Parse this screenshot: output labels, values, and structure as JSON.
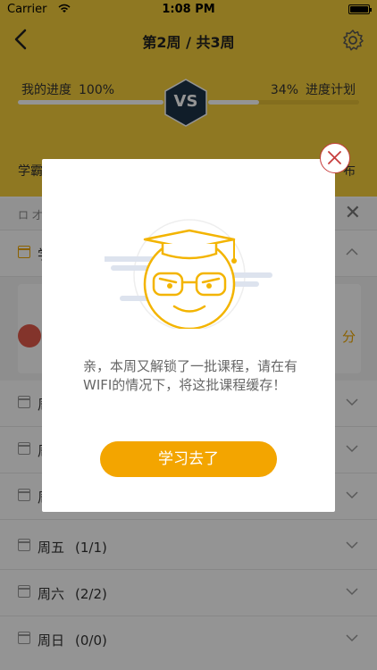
{
  "status_bar": {
    "carrier": "Carrier",
    "time": "1:08 PM",
    "battery_level": 1.0
  },
  "nav": {
    "title": "第2周 / 共3周",
    "back_icon": "chevron-left-icon",
    "settings_icon": "gear-icon"
  },
  "progress": {
    "mine_label": "我的进度",
    "mine_value": "100%",
    "mine_fraction": 1.0,
    "plan_value": "34%",
    "plan_label": "进度计划",
    "plan_fraction": 0.34,
    "vs_label": "VS"
  },
  "ranking": {
    "label": "学霸",
    "right_partial": "布"
  },
  "notice": {
    "speaker_partial": "ロ 才"
  },
  "days": [
    {
      "label": "学",
      "count": "",
      "active": true
    },
    {
      "label": "周",
      "count": "",
      "active": false
    },
    {
      "label": "周",
      "count": "",
      "active": false
    },
    {
      "label": "周",
      "count": "",
      "active": false
    },
    {
      "label": "周五",
      "count": "(1/1)",
      "active": false
    },
    {
      "label": "周六",
      "count": "(2/2)",
      "active": false
    },
    {
      "label": "周日",
      "count": "(0/0)",
      "active": false
    }
  ],
  "course": {
    "score_partial": "分"
  },
  "modal": {
    "message": "亲，本周又解锁了一批课程，请在有WIFI的情况下，将这批课程缓存！",
    "cta_label": "学习去了",
    "mascot": "graduate-mascot-icon",
    "close_icon": "close-icon"
  },
  "colors": {
    "header": "#f6cf3c",
    "accent": "#f3a500",
    "close_ring": "#c73d3d",
    "badge": "#1d3347"
  }
}
